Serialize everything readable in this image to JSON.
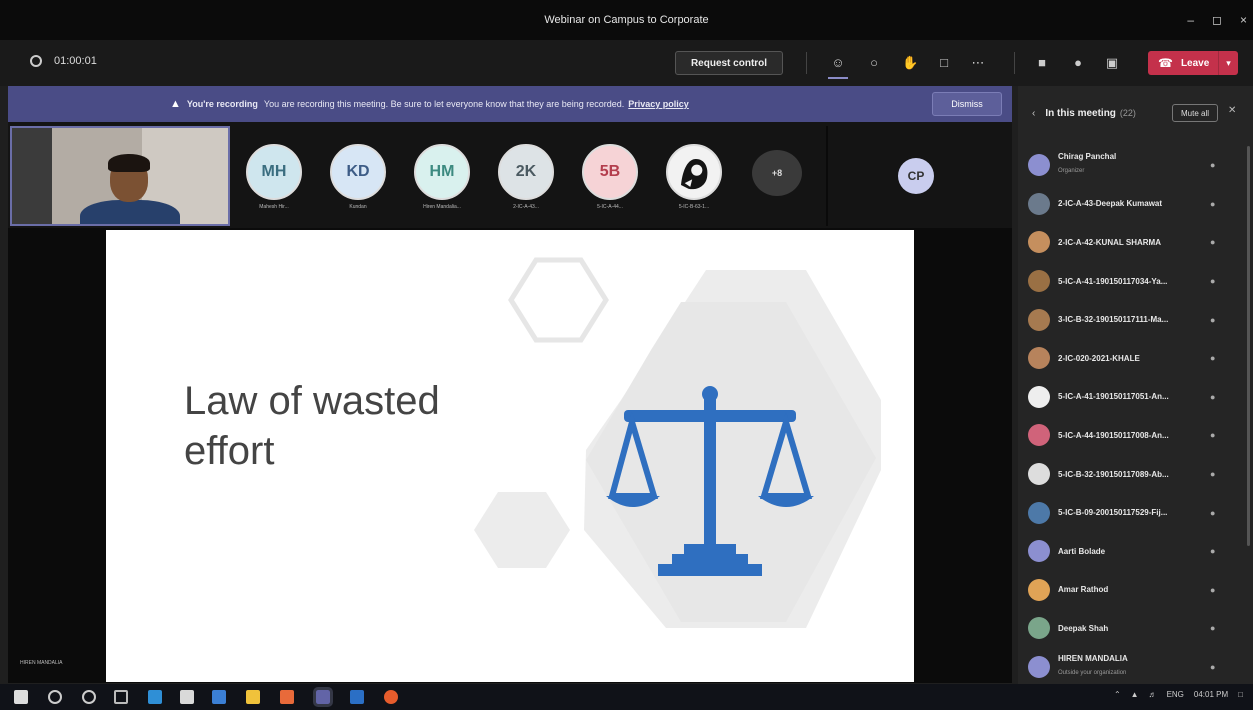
{
  "window": {
    "title": "Webinar on Campus to Corporate",
    "controls": [
      "–",
      "◻",
      "×"
    ]
  },
  "toolbar": {
    "timer": "01:00:01",
    "request_control": "Request control",
    "leave": "Leave",
    "icons": [
      "people-icon",
      "chat-icon",
      "reaction-icon",
      "rooms-icon",
      "more-icon",
      "camera-icon",
      "mic-icon",
      "share-icon"
    ]
  },
  "banner": {
    "bold": "You're recording",
    "text": "You are recording this meeting. Be sure to let everyone know that they are being recorded.",
    "link": "Privacy policy",
    "dismiss": "Dismiss"
  },
  "strip": {
    "avatars": [
      {
        "initials": "MH",
        "name": "Mahesh Hir...",
        "bg": "#cfe6ee",
        "fg": "#3b6e80"
      },
      {
        "initials": "KD",
        "name": "Kundan",
        "bg": "#d7e6f5",
        "fg": "#3d5c86"
      },
      {
        "initials": "HM",
        "name": "Hiren Mandalia...",
        "bg": "#d9f1ee",
        "fg": "#3c8a80"
      },
      {
        "initials": "2K",
        "name": "2-IC-A-43...",
        "bg": "#dde3e6",
        "fg": "#4b5a61"
      },
      {
        "initials": "5B",
        "name": "5-IC-A-44...",
        "bg": "#f6d3d6",
        "fg": "#b33d4d"
      },
      {
        "initials": "",
        "name": "5-IC-B-63-1...",
        "bg": "#222",
        "fg": "#fff"
      }
    ],
    "more": "+8",
    "right_initials": "CP"
  },
  "slide": {
    "title": "Law of wasted effort"
  },
  "presenter": "HIREN MANDALIA",
  "panel": {
    "title": "In this meeting",
    "count": "(22)",
    "mute_all": "Mute all",
    "participants": [
      {
        "name": "Chirag Panchal",
        "sub": "Organizer",
        "color": "#8c8fd0"
      },
      {
        "name": "2-IC-A-43-Deepak Kumawat",
        "sub": "",
        "color": "#6b7a8c"
      },
      {
        "name": "2-IC-A-42-KUNAL SHARMA",
        "sub": "",
        "color": "#c58f5e"
      },
      {
        "name": "5-IC-A-41-190150117034-Ya...",
        "sub": "",
        "color": "#9a7044"
      },
      {
        "name": "3-IC-B-32-190150117111-Ma...",
        "sub": "",
        "color": "#a67a50"
      },
      {
        "name": "2-IC-020-2021-KHALE",
        "sub": "",
        "color": "#b7835c"
      },
      {
        "name": "5-IC-A-41-190150117051-An...",
        "sub": "",
        "color": "#eeeeee"
      },
      {
        "name": "5-IC-A-44-190150117008-An...",
        "sub": "",
        "color": "#d0637a"
      },
      {
        "name": "5-IC-B-32-190150117089-Ab...",
        "sub": "",
        "color": "#dddddd"
      },
      {
        "name": "5-IC-B-09-200150117529-Fij...",
        "sub": "",
        "color": "#4d79a8"
      },
      {
        "name": "Aarti Bolade",
        "sub": "",
        "color": "#8c8fd0"
      },
      {
        "name": "Amar Rathod",
        "sub": "",
        "color": "#e0a356"
      },
      {
        "name": "Deepak Shah",
        "sub": "",
        "color": "#7aa58a"
      },
      {
        "name": "HIREN MANDALIA",
        "sub": "Outside your organization",
        "color": "#8c8fd0"
      }
    ]
  },
  "taskbar": {
    "time": "04:01 PM",
    "lang": "ENG"
  },
  "colors": {
    "banner": "#4a4c86",
    "leave": "#c4314b",
    "accent": "#6b6ea8",
    "scale_blue": "#2f6fc0"
  }
}
